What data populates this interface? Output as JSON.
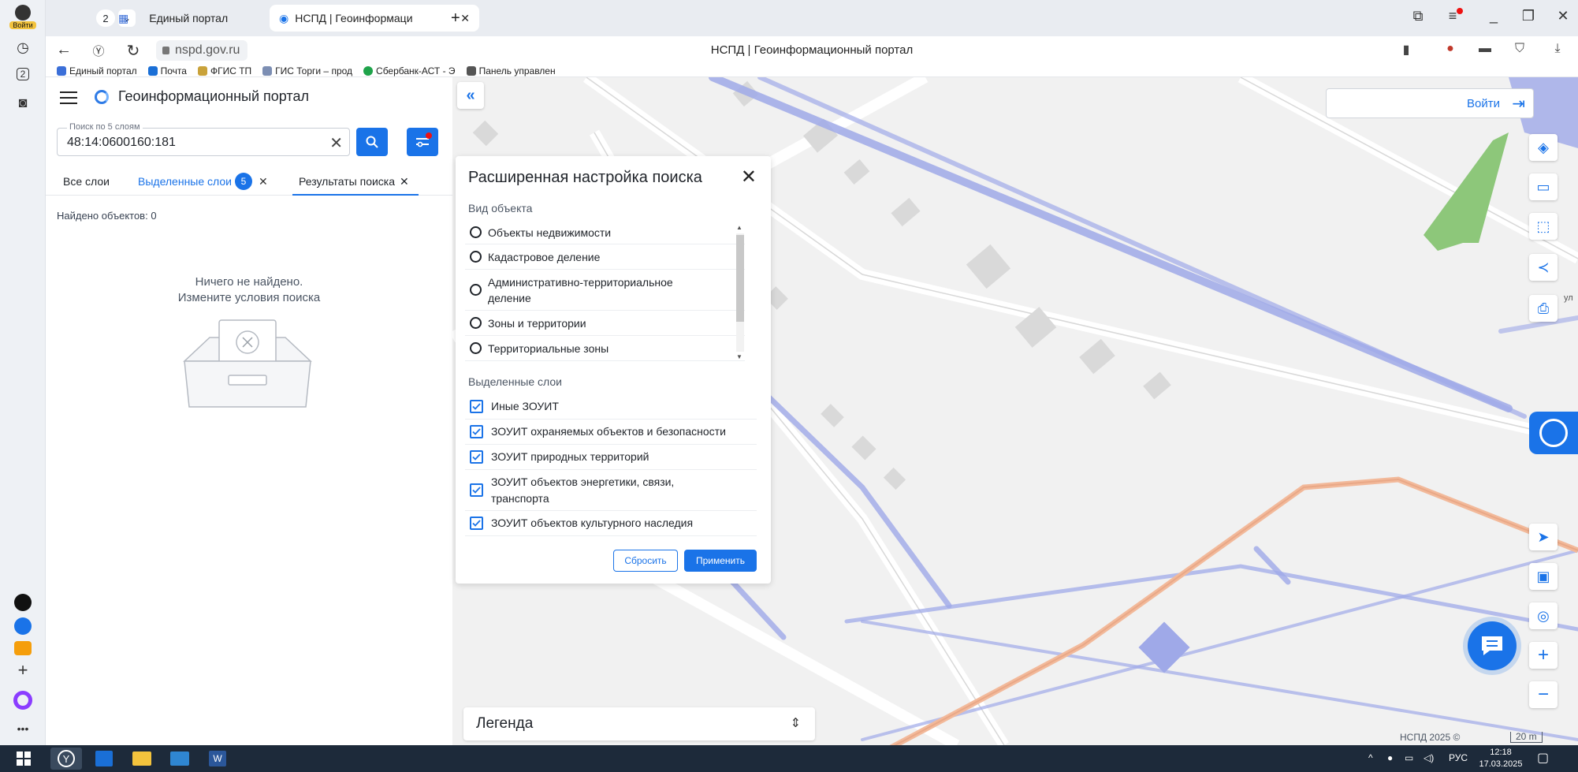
{
  "browser": {
    "login_badge": "Войти",
    "tab_counter": "2",
    "tabs": [
      {
        "title": "Единый портал"
      },
      {
        "title": "НСПД | Геоинформаци"
      }
    ],
    "url": "nspd.gov.ru",
    "page_title": "НСПД | Геоинформационный портал",
    "bookmarks": [
      {
        "label": "Единый портал",
        "color": "#3b6fd8"
      },
      {
        "label": "Почта",
        "color": "#1a6fd6"
      },
      {
        "label": "ФГИС ТП",
        "color": "#c9a23a"
      },
      {
        "label": "ГИС Торги – прод",
        "color": "#7c8eb3"
      },
      {
        "label": "Сбербанк-АСТ - Э",
        "color": "#1fa34a"
      },
      {
        "label": "Панель управлен",
        "color": "#555555"
      }
    ],
    "rail_counter": "2"
  },
  "portal": {
    "title": "Геоинформационный портал",
    "search": {
      "label": "Поиск по 5 слоям",
      "value": "48:14:0600160:181"
    },
    "tabs": {
      "all_layers": "Все слои",
      "selected_layers": "Выделенные слои",
      "selected_count": "5",
      "results": "Результаты поиска"
    },
    "found": "Найдено объектов: 0",
    "empty_line1": "Ничего не найдено.",
    "empty_line2": "Измените условия поиска"
  },
  "dialog": {
    "title": "Расширенная настройка поиска",
    "object_type_label": "Вид объекта",
    "object_types": [
      "Объекты недвижимости",
      "Кадастровое деление",
      "Административно-территориальное деление",
      "Зоны и территории",
      "Территориальные зоны"
    ],
    "selected_layers_label": "Выделенные слои",
    "layers": [
      "Иные ЗОУИТ",
      "ЗОУИТ охраняемых объектов и безопасности",
      "ЗОУИТ природных территорий",
      "ЗОУИТ объектов энергетики, связи, транспорта",
      "ЗОУИТ объектов культурного наследия"
    ],
    "reset": "Сбросить",
    "apply": "Применить"
  },
  "map": {
    "login": "Войти",
    "legend": "Легенда",
    "credit": "НСПД 2025 ©",
    "scale": "20 m",
    "road_label": "ул"
  },
  "taskbar": {
    "lang": "РУС",
    "time": "12:18",
    "date": "17.03.2025"
  },
  "colors": {
    "accent": "#1a73e8",
    "zone": "#9fa9e8",
    "pipeline": "#f2b99a",
    "park": "#8dc77a"
  }
}
